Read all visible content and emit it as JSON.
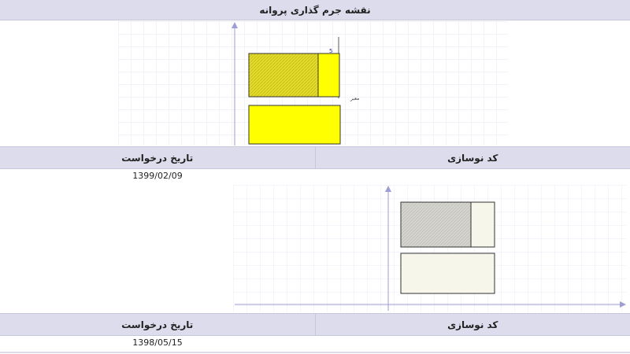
{
  "title": "نقشه جرم گذاری پروانه",
  "records": [
    {
      "headers": {
        "code": "کد نوسازی",
        "date": "تاریخ درخواست"
      },
      "values": {
        "code": "",
        "date": "1399/02/09"
      },
      "plan": {
        "edge_label": "5",
        "side_label": "معبر",
        "colors": {
          "hatched": "#e6dc2a",
          "fill": "#ffff00"
        }
      }
    },
    {
      "headers": {
        "code": "کد نوسازی",
        "date": "تاریخ درخواست"
      },
      "values": {
        "code": "",
        "date": "1398/05/15"
      },
      "plan": {
        "colors": {
          "hatched": "#d6d6d0",
          "fill": "#f6f6ea"
        }
      }
    }
  ],
  "colors": {
    "header_bg": "#dcdcec",
    "grid": "#e8e8f4",
    "axis": "#9e9ed2"
  }
}
